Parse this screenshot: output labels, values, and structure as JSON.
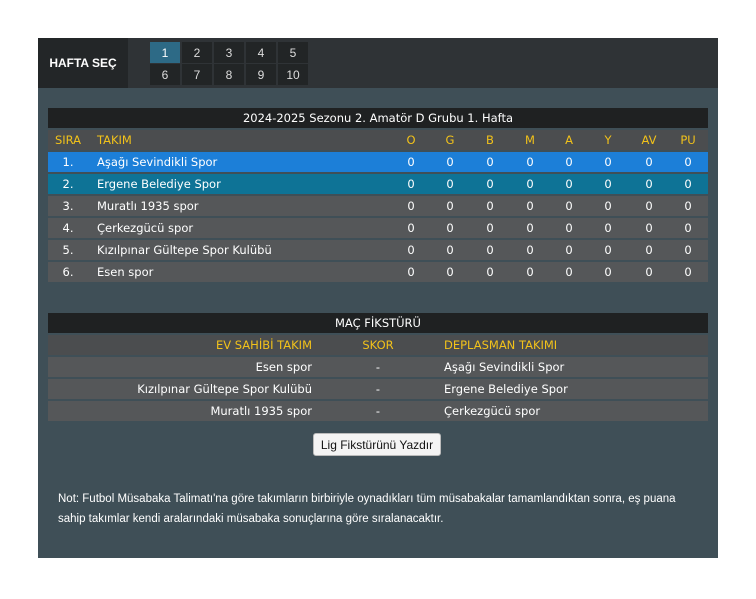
{
  "week_selector": {
    "label": "HAFTA SEÇ",
    "weeks": [
      "1",
      "2",
      "3",
      "4",
      "5",
      "6",
      "7",
      "8",
      "9",
      "10"
    ],
    "active": "1"
  },
  "standings": {
    "title": "2024-2025 Sezonu 2. Amatör D Grubu 1. Hafta",
    "headers": {
      "sira": "SIRA",
      "takim": "TAKIM",
      "o": "O",
      "g": "G",
      "b": "B",
      "m": "M",
      "a": "A",
      "y": "Y",
      "av": "AV",
      "pu": "PU"
    },
    "rows": [
      {
        "sira": "1.",
        "takim": "Aşağı Sevindikli Spor",
        "o": "0",
        "g": "0",
        "b": "0",
        "m": "0",
        "a": "0",
        "y": "0",
        "av": "0",
        "pu": "0"
      },
      {
        "sira": "2.",
        "takim": "Ergene Belediye Spor",
        "o": "0",
        "g": "0",
        "b": "0",
        "m": "0",
        "a": "0",
        "y": "0",
        "av": "0",
        "pu": "0"
      },
      {
        "sira": "3.",
        "takim": "Muratlı 1935 spor",
        "o": "0",
        "g": "0",
        "b": "0",
        "m": "0",
        "a": "0",
        "y": "0",
        "av": "0",
        "pu": "0"
      },
      {
        "sira": "4.",
        "takim": "Çerkezgücü spor",
        "o": "0",
        "g": "0",
        "b": "0",
        "m": "0",
        "a": "0",
        "y": "0",
        "av": "0",
        "pu": "0"
      },
      {
        "sira": "5.",
        "takim": "Kızılpınar Gültepe Spor Kulübü",
        "o": "0",
        "g": "0",
        "b": "0",
        "m": "0",
        "a": "0",
        "y": "0",
        "av": "0",
        "pu": "0"
      },
      {
        "sira": "6.",
        "takim": "Esen spor",
        "o": "0",
        "g": "0",
        "b": "0",
        "m": "0",
        "a": "0",
        "y": "0",
        "av": "0",
        "pu": "0"
      }
    ],
    "colors": {
      "first": "#1c7fd8",
      "second": "#0e7396",
      "header_text": "#f2c21a"
    }
  },
  "fixture": {
    "title": "MAÇ FİKSTÜRÜ",
    "headers": {
      "home": "EV SAHİBİ TAKIM",
      "score": "SKOR",
      "away": "DEPLASMAN TAKIMI"
    },
    "matches": [
      {
        "home": "Esen spor",
        "score": "-",
        "away": "Aşağı Sevindikli Spor"
      },
      {
        "home": "Kızılpınar Gültepe Spor Kulübü",
        "score": "-",
        "away": "Ergene Belediye Spor"
      },
      {
        "home": "Muratlı 1935 spor",
        "score": "-",
        "away": "Çerkezgücü spor"
      }
    ]
  },
  "print_button": "Lig Fikstürünü Yazdır",
  "note": "Not: Futbol Müsabaka Talimatı'na göre takımların birbiriyle oynadıkları tüm müsabakalar tamamlandıktan sonra, eş puana sahip takımlar kendi aralarındaki müsabaka sonuçlarına göre sıralanacaktır."
}
